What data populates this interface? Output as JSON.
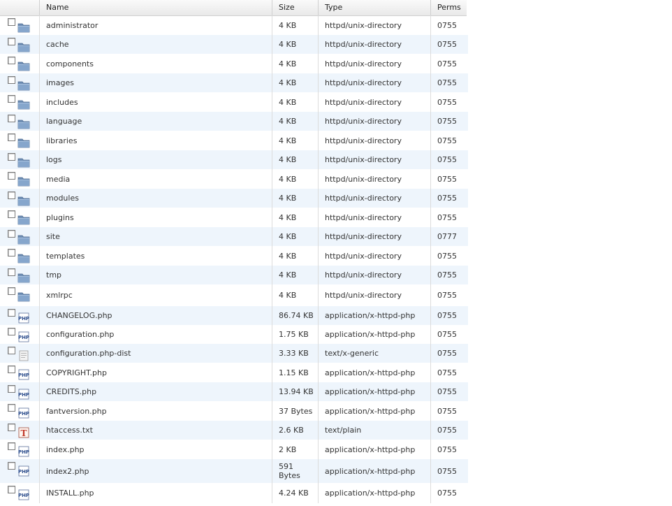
{
  "columns": {
    "name": "Name",
    "size": "Size",
    "type": "Type",
    "perms": "Perms"
  },
  "files": [
    {
      "icon": "folder-icon",
      "name": "administrator",
      "size": "4 KB",
      "type": "httpd/unix-directory",
      "perms": "0755"
    },
    {
      "icon": "folder-icon",
      "name": "cache",
      "size": "4 KB",
      "type": "httpd/unix-directory",
      "perms": "0755"
    },
    {
      "icon": "folder-icon",
      "name": "components",
      "size": "4 KB",
      "type": "httpd/unix-directory",
      "perms": "0755"
    },
    {
      "icon": "folder-icon",
      "name": "images",
      "size": "4 KB",
      "type": "httpd/unix-directory",
      "perms": "0755"
    },
    {
      "icon": "folder-icon",
      "name": "includes",
      "size": "4 KB",
      "type": "httpd/unix-directory",
      "perms": "0755"
    },
    {
      "icon": "folder-icon",
      "name": "language",
      "size": "4 KB",
      "type": "httpd/unix-directory",
      "perms": "0755"
    },
    {
      "icon": "folder-icon",
      "name": "libraries",
      "size": "4 KB",
      "type": "httpd/unix-directory",
      "perms": "0755"
    },
    {
      "icon": "folder-icon",
      "name": "logs",
      "size": "4 KB",
      "type": "httpd/unix-directory",
      "perms": "0755"
    },
    {
      "icon": "folder-icon",
      "name": "media",
      "size": "4 KB",
      "type": "httpd/unix-directory",
      "perms": "0755"
    },
    {
      "icon": "folder-icon",
      "name": "modules",
      "size": "4 KB",
      "type": "httpd/unix-directory",
      "perms": "0755"
    },
    {
      "icon": "folder-icon",
      "name": "plugins",
      "size": "4 KB",
      "type": "httpd/unix-directory",
      "perms": "0755"
    },
    {
      "icon": "folder-icon",
      "name": "site",
      "size": "4 KB",
      "type": "httpd/unix-directory",
      "perms": "0777"
    },
    {
      "icon": "folder-icon",
      "name": "templates",
      "size": "4 KB",
      "type": "httpd/unix-directory",
      "perms": "0755"
    },
    {
      "icon": "folder-icon",
      "name": "tmp",
      "size": "4 KB",
      "type": "httpd/unix-directory",
      "perms": "0755"
    },
    {
      "icon": "folder-icon",
      "name": "xmlrpc",
      "size": "4 KB",
      "type": "httpd/unix-directory",
      "perms": "0755"
    },
    {
      "icon": "php-file-icon",
      "name": "CHANGELOG.php",
      "size": "86.74 KB",
      "type": "application/x-httpd-php",
      "perms": "0755"
    },
    {
      "icon": "php-file-icon",
      "name": "configuration.php",
      "size": "1.75 KB",
      "type": "application/x-httpd-php",
      "perms": "0755"
    },
    {
      "icon": "generic-file-icon",
      "name": "configuration.php-dist",
      "size": "3.33 KB",
      "type": "text/x-generic",
      "perms": "0755"
    },
    {
      "icon": "php-file-icon",
      "name": "COPYRIGHT.php",
      "size": "1.15 KB",
      "type": "application/x-httpd-php",
      "perms": "0755"
    },
    {
      "icon": "php-file-icon",
      "name": "CREDITS.php",
      "size": "13.94 KB",
      "type": "application/x-httpd-php",
      "perms": "0755"
    },
    {
      "icon": "php-file-icon",
      "name": "fantversion.php",
      "size": "37 Bytes",
      "type": "application/x-httpd-php",
      "perms": "0755"
    },
    {
      "icon": "text-file-icon",
      "name": "htaccess.txt",
      "size": "2.6 KB",
      "type": "text/plain",
      "perms": "0755"
    },
    {
      "icon": "php-file-icon",
      "name": "index.php",
      "size": "2 KB",
      "type": "application/x-httpd-php",
      "perms": "0755"
    },
    {
      "icon": "php-file-icon",
      "name": "index2.php",
      "size": "591 Bytes",
      "type": "application/x-httpd-php",
      "perms": "0755"
    },
    {
      "icon": "php-file-icon",
      "name": "INSTALL.php",
      "size": "4.24 KB",
      "type": "application/x-httpd-php",
      "perms": "0755"
    }
  ]
}
